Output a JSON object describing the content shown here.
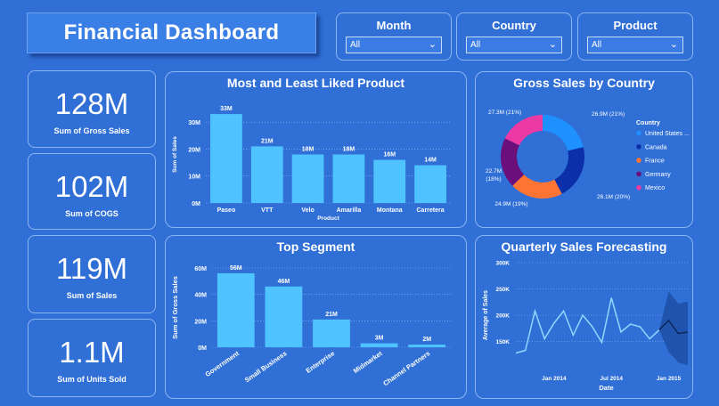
{
  "header": {
    "title": "Financial Dashboard"
  },
  "slicers": [
    {
      "label": "Month",
      "value": "All"
    },
    {
      "label": "Country",
      "value": "All"
    },
    {
      "label": "Product",
      "value": "All"
    }
  ],
  "kpis": [
    {
      "value": "128M",
      "label": "Sum of Gross Sales"
    },
    {
      "value": "102M",
      "label": "Sum of COGS"
    },
    {
      "value": "119M",
      "label": "Sum of Sales"
    },
    {
      "value": "1.1M",
      "label": "Sum of Units Sold"
    }
  ],
  "colors": {
    "background": "#2f6fd6",
    "bar": "#4fc3ff",
    "line": "#8fd8ff",
    "forecast_band": "#1d4fa3"
  },
  "chart_data": [
    {
      "id": "products",
      "type": "bar",
      "title": "Most and Least Liked Product",
      "xlabel": "Product",
      "ylabel": "Sum of Sales",
      "categories": [
        "Paseo",
        "VTT",
        "Velo",
        "Amarilla",
        "Montana",
        "Carretera"
      ],
      "values": [
        33,
        21,
        18,
        18,
        16,
        14
      ],
      "data_labels": [
        "33M",
        "21M",
        "18M",
        "18M",
        "16M",
        "14M"
      ],
      "ylim": [
        0,
        36
      ],
      "yticks": [
        0,
        10,
        20,
        30
      ],
      "ytick_labels": [
        "0M",
        "10M",
        "20M",
        "30M"
      ],
      "grid": true
    },
    {
      "id": "country",
      "type": "pie",
      "title": "Gross Sales by Country",
      "legend_title": "Country",
      "legend_position": "right",
      "labels": [
        "United States ...",
        "Canada",
        "France",
        "Germany",
        "Mexico"
      ],
      "values": [
        27.3,
        26.9,
        26.1,
        24.9,
        22.7
      ],
      "data_labels": [
        "27.3M (21%)",
        "26.9M (21%)",
        "26.1M (20%)",
        "24.9M (19%)",
        "22.7M (18%)"
      ],
      "colors": [
        "#1e90ff",
        "#0b2fa8",
        "#ff7433",
        "#6b0f7a",
        "#ec3aa5"
      ]
    },
    {
      "id": "segment",
      "type": "bar",
      "title": "Top Segment",
      "ylabel": "Sum of Gross Sales",
      "categories": [
        "Government",
        "Small Business",
        "Enterprise",
        "Midmarket",
        "Channel Partners"
      ],
      "values": [
        56,
        46,
        21,
        3,
        2
      ],
      "data_labels": [
        "56M",
        "46M",
        "21M",
        "3M",
        "2M"
      ],
      "ylim": [
        0,
        60
      ],
      "yticks": [
        0,
        20,
        40,
        60
      ],
      "ytick_labels": [
        "0M",
        "20M",
        "40M",
        "60M"
      ],
      "grid": true
    },
    {
      "id": "forecast",
      "type": "line",
      "title": "Quarterly Sales Forecasting",
      "xlabel": "Date",
      "ylabel": "Average of Sales",
      "x": [
        "2013-09",
        "2013-10",
        "2013-11",
        "2013-12",
        "2014-01",
        "2014-02",
        "2014-03",
        "2014-04",
        "2014-05",
        "2014-06",
        "2014-07",
        "2014-08",
        "2014-09",
        "2014-10",
        "2014-11",
        "2014-12"
      ],
      "y": [
        128,
        133,
        208,
        155,
        185,
        208,
        162,
        200,
        178,
        148,
        233,
        168,
        183,
        178,
        155,
        172
      ],
      "forecast_x": [
        "2014-12",
        "2015-01",
        "2015-02",
        "2015-03"
      ],
      "forecast_y": [
        172,
        190,
        165,
        168
      ],
      "forecast_upper": [
        172,
        245,
        222,
        226
      ],
      "forecast_lower": [
        172,
        130,
        110,
        105
      ],
      "ylim": [
        100,
        300
      ],
      "yticks": [
        150,
        200,
        250,
        300
      ],
      "ytick_labels": [
        "150K",
        "200K",
        "250K",
        "300K"
      ],
      "xtick_labels": [
        "Jan 2014",
        "Jul 2014",
        "Jan 2015"
      ],
      "grid": true
    }
  ]
}
